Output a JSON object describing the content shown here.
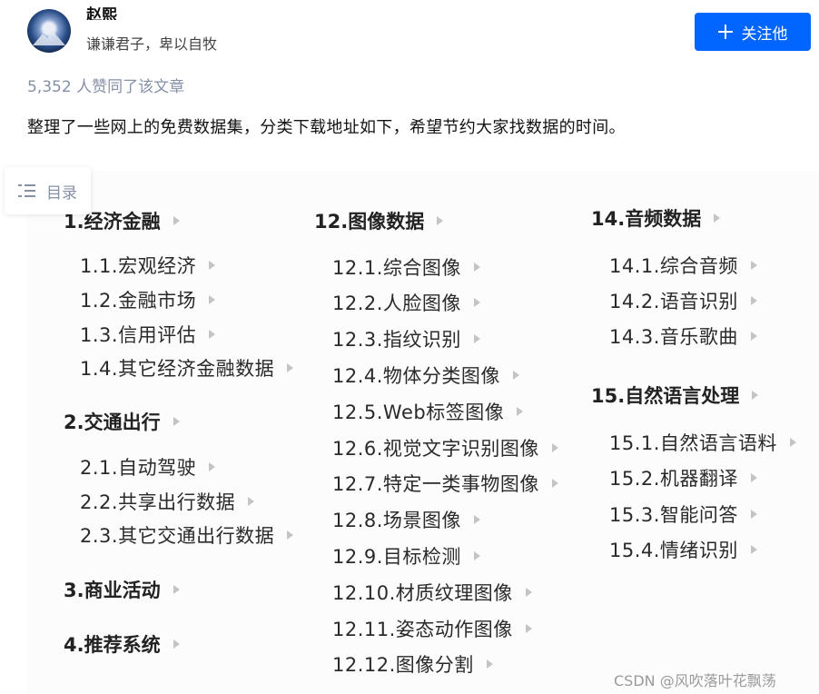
{
  "author": {
    "name": "赵熙",
    "bio": "谦谦君子，卑以自牧",
    "follow_label": "关注他"
  },
  "likes": "5,352 人赞同了该文章",
  "intro": "整理了一些网上的免费数据集，分类下载地址如下，希望节约大家找数据的时间。",
  "toc_label": "目录",
  "categories": {
    "c1": {
      "title": "1.经济金融",
      "items": [
        "1.1.宏观经济",
        "1.2.金融市场",
        "1.3.信用评估",
        "1.4.其它经济金融数据"
      ]
    },
    "c2": {
      "title": "2.交通出行",
      "items": [
        "2.1.自动驾驶",
        "2.2.共享出行数据",
        "2.3.其它交通出行数据"
      ]
    },
    "c3": {
      "title": "3.商业活动"
    },
    "c4": {
      "title": "4.推荐系统"
    },
    "c12": {
      "title": "12.图像数据",
      "items": [
        "12.1.综合图像",
        "12.2.人脸图像",
        "12.3.指纹识别",
        "12.4.物体分类图像",
        "12.5.Web标签图像",
        "12.6.视觉文字识别图像",
        "12.7.特定一类事物图像",
        "12.8.场景图像",
        "12.9.目标检测",
        "12.10.材质纹理图像",
        "12.11.姿态动作图像",
        "12.12.图像分割"
      ]
    },
    "c14": {
      "title": "14.音频数据",
      "items": [
        "14.1.综合音频",
        "14.2.语音识别",
        "14.3.音乐歌曲"
      ]
    },
    "c15": {
      "title": "15.自然语言处理",
      "items": [
        "15.1.自然语言语料",
        "15.2.机器翻译",
        "15.3.智能问答",
        "15.4.情绪识别"
      ]
    }
  },
  "watermark": "CSDN @风吹落叶花飘荡",
  "colors": {
    "accent": "#0066ff",
    "muted": "#8590a6"
  }
}
